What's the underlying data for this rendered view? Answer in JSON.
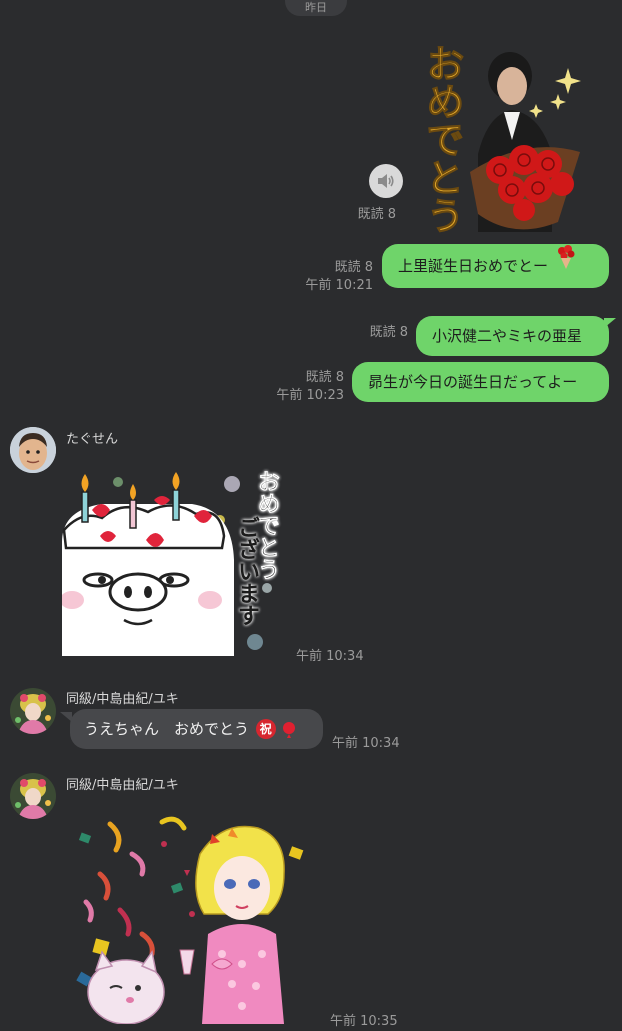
{
  "date_label": "昨日",
  "messages": {
    "sticker1": {
      "text": "おめでとう",
      "read": "既読 8"
    },
    "msg1": {
      "text": "上里誕生日おめでとー",
      "read": "既読 8",
      "time": "午前 10:21"
    },
    "msg2": {
      "text": "小沢健二やミキの亜星",
      "read": "既読 8"
    },
    "msg3": {
      "text": "昴生が今日の誕生日だってよー",
      "read": "既読 8",
      "time": "午前 10:23"
    },
    "tagusen": {
      "sender": "たぐせん",
      "sticker_text_1": "おめでとう",
      "sticker_text_2": "ございます",
      "time": "午前 10:34"
    },
    "yuki1": {
      "sender": "同級/中島由紀/ユキ",
      "text": "うえちゃん　おめでとう",
      "emoji": "祝",
      "time": "午前 10:34"
    },
    "yuki2": {
      "sender": "同級/中島由紀/ユキ",
      "time": "午前 10:35"
    }
  },
  "colors": {
    "background": "#2b2c2e",
    "outgoing_bubble": "#6fd46a",
    "incoming_bubble": "#47484b"
  }
}
